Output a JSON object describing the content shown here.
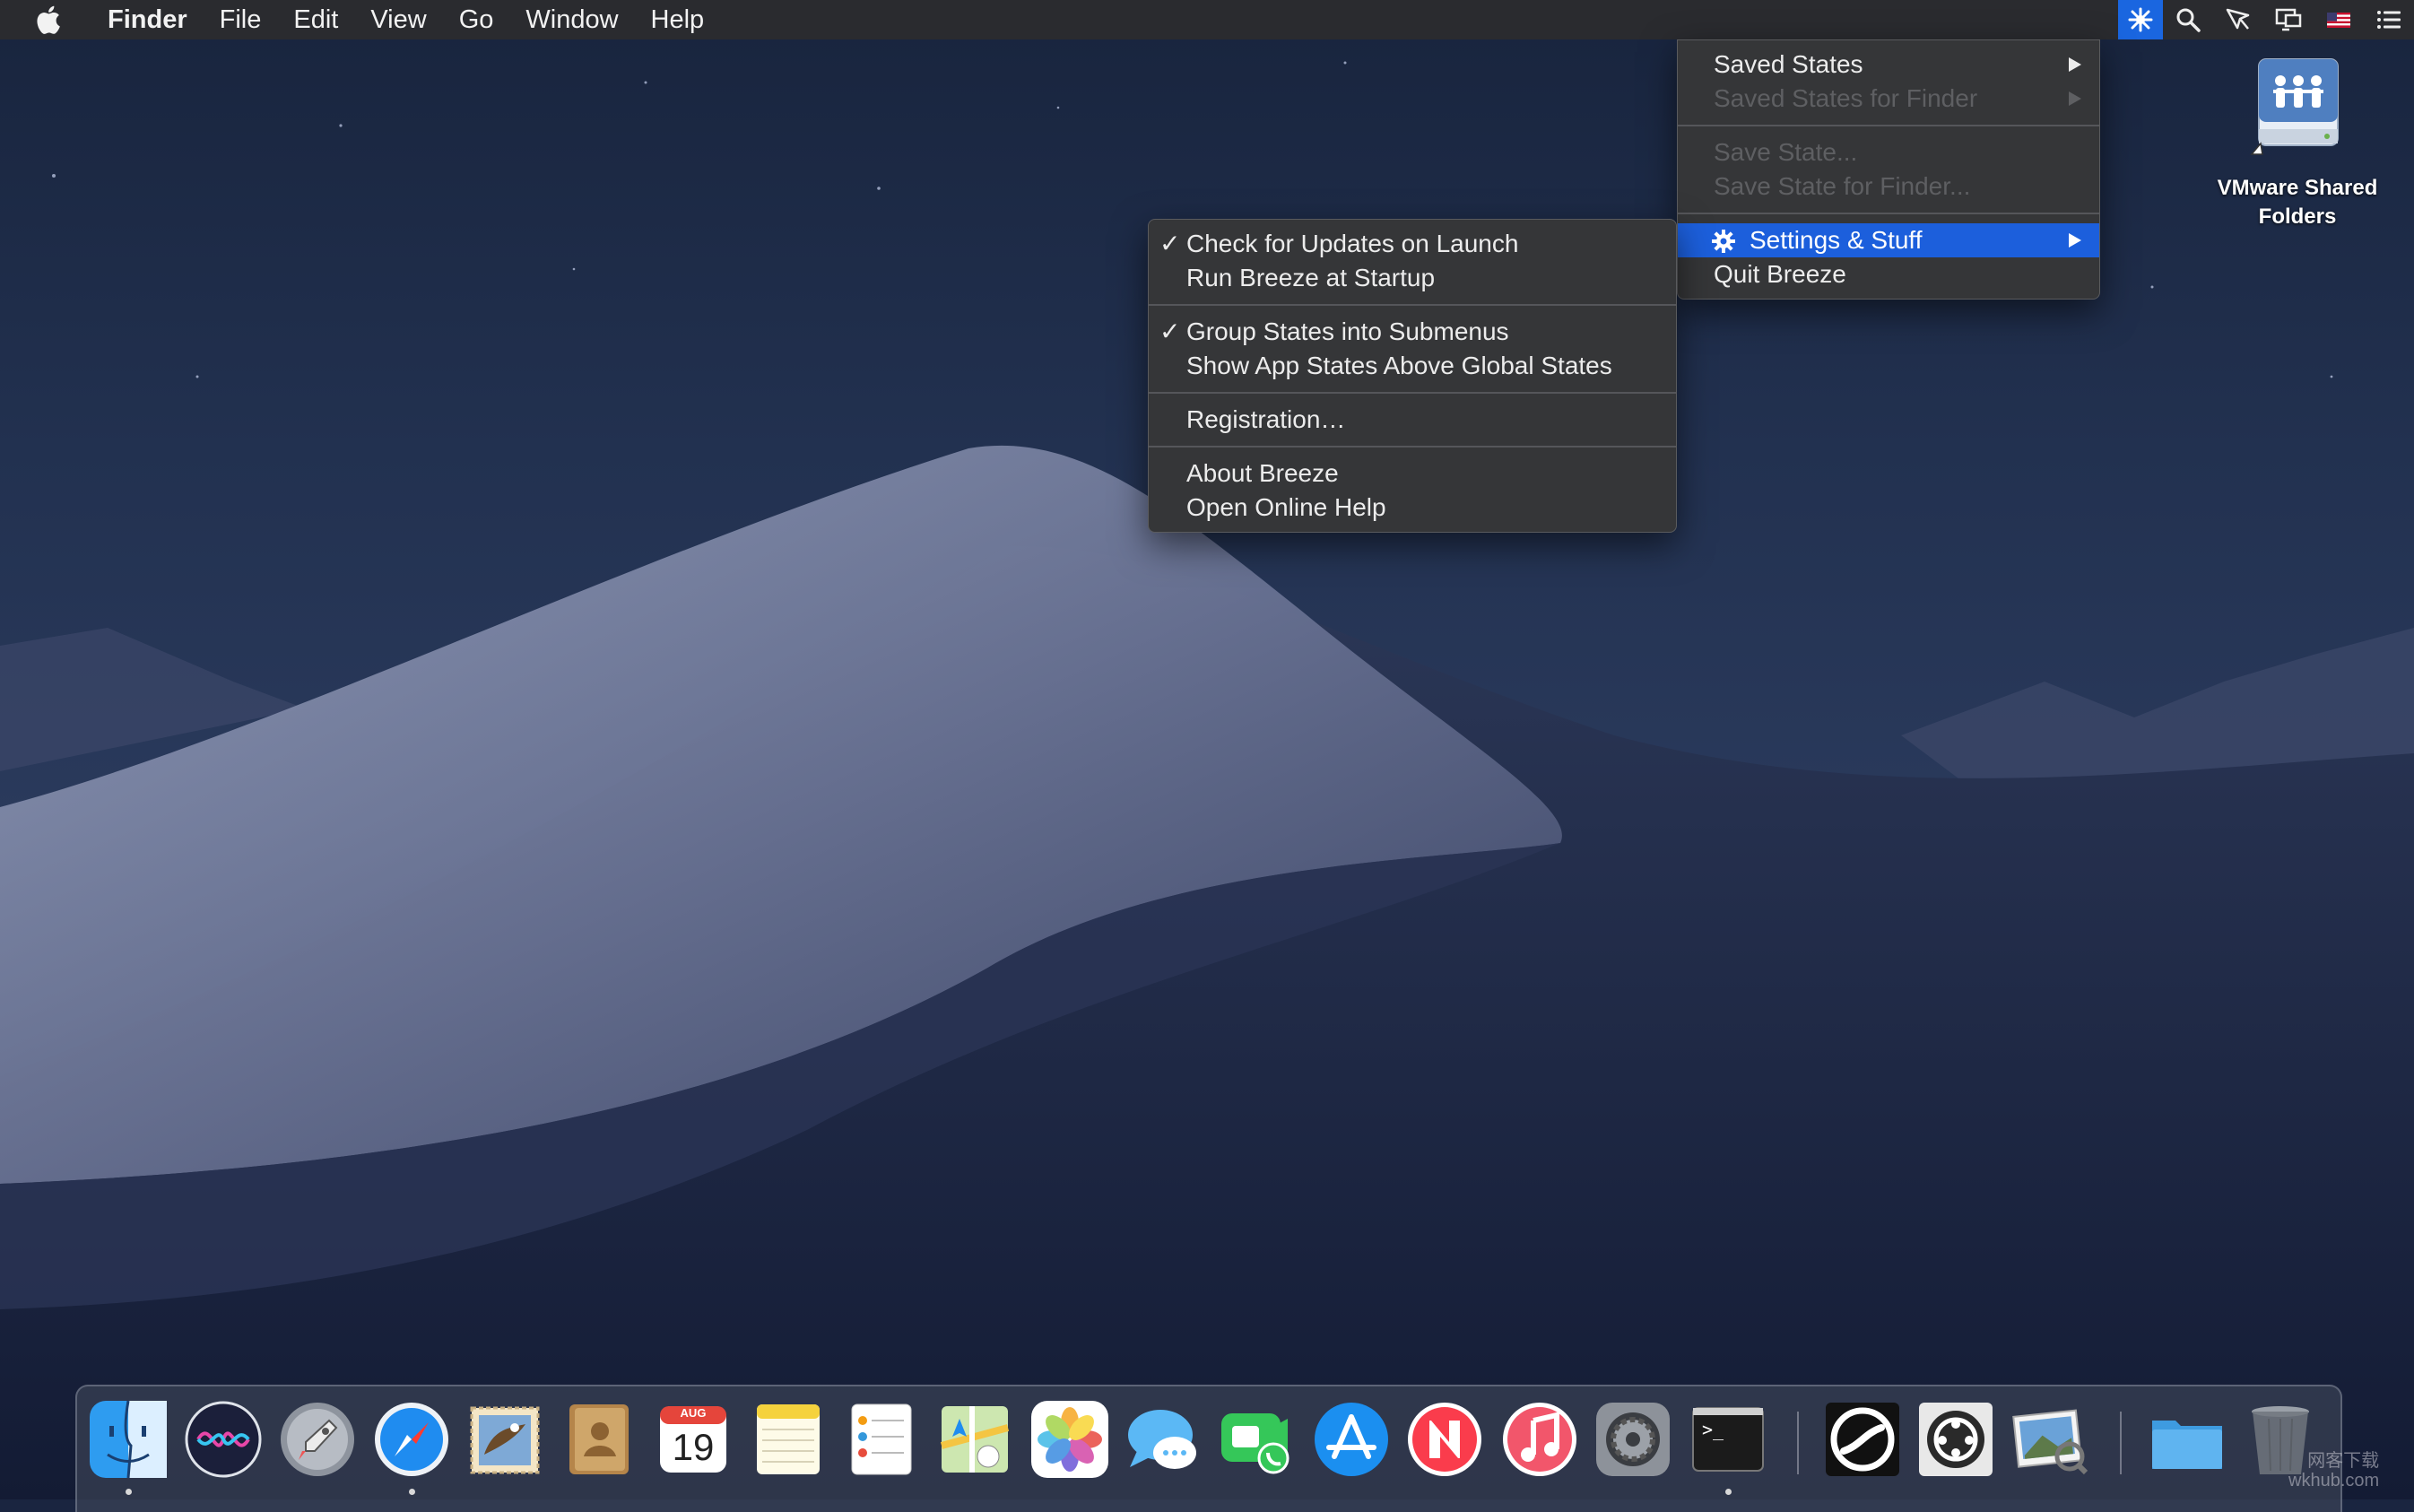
{
  "menubar": {
    "app_name": "Finder",
    "items": [
      "File",
      "Edit",
      "View",
      "Go",
      "Window",
      "Help"
    ],
    "status_icons": [
      "breeze-icon",
      "spotlight-search-icon",
      "cursor-pen-icon",
      "display-mirroring-icon",
      "us-flag-input-icon",
      "notification-center-icon"
    ]
  },
  "breeze_menu": {
    "saved_states": "Saved States",
    "saved_states_finder": "Saved States for Finder",
    "save_state": "Save State...",
    "save_state_finder": "Save State for Finder...",
    "settings": "Settings & Stuff",
    "quit": "Quit Breeze"
  },
  "settings_menu": {
    "check_updates": "Check for Updates on Launch",
    "run_startup": "Run Breeze at Startup",
    "group_states": "Group States into Submenus",
    "show_app_states": "Show App States Above Global States",
    "registration": "Registration…",
    "about": "About Breeze",
    "help": "Open Online Help",
    "check_mark": "✓"
  },
  "desktop": {
    "shared_folders_line1": "VMware Shared",
    "shared_folders_line2": "Folders"
  },
  "dock": {
    "apps": [
      "Finder",
      "Siri",
      "Launchpad",
      "Safari",
      "Mail",
      "Contacts",
      "Calendar",
      "Notes",
      "Reminders",
      "Maps",
      "Photos",
      "Messages",
      "FaceTime",
      "App Store",
      "News",
      "iTunes",
      "System Preferences",
      "Terminal",
      "Breeze",
      "Breeze Helper",
      "Preview",
      "Downloads",
      "Trash"
    ],
    "calendar_month": "AUG",
    "calendar_day": "19",
    "terminal_prompt": ">_"
  },
  "watermark": {
    "line1": "网客下载",
    "line2": "wkhub.com"
  }
}
